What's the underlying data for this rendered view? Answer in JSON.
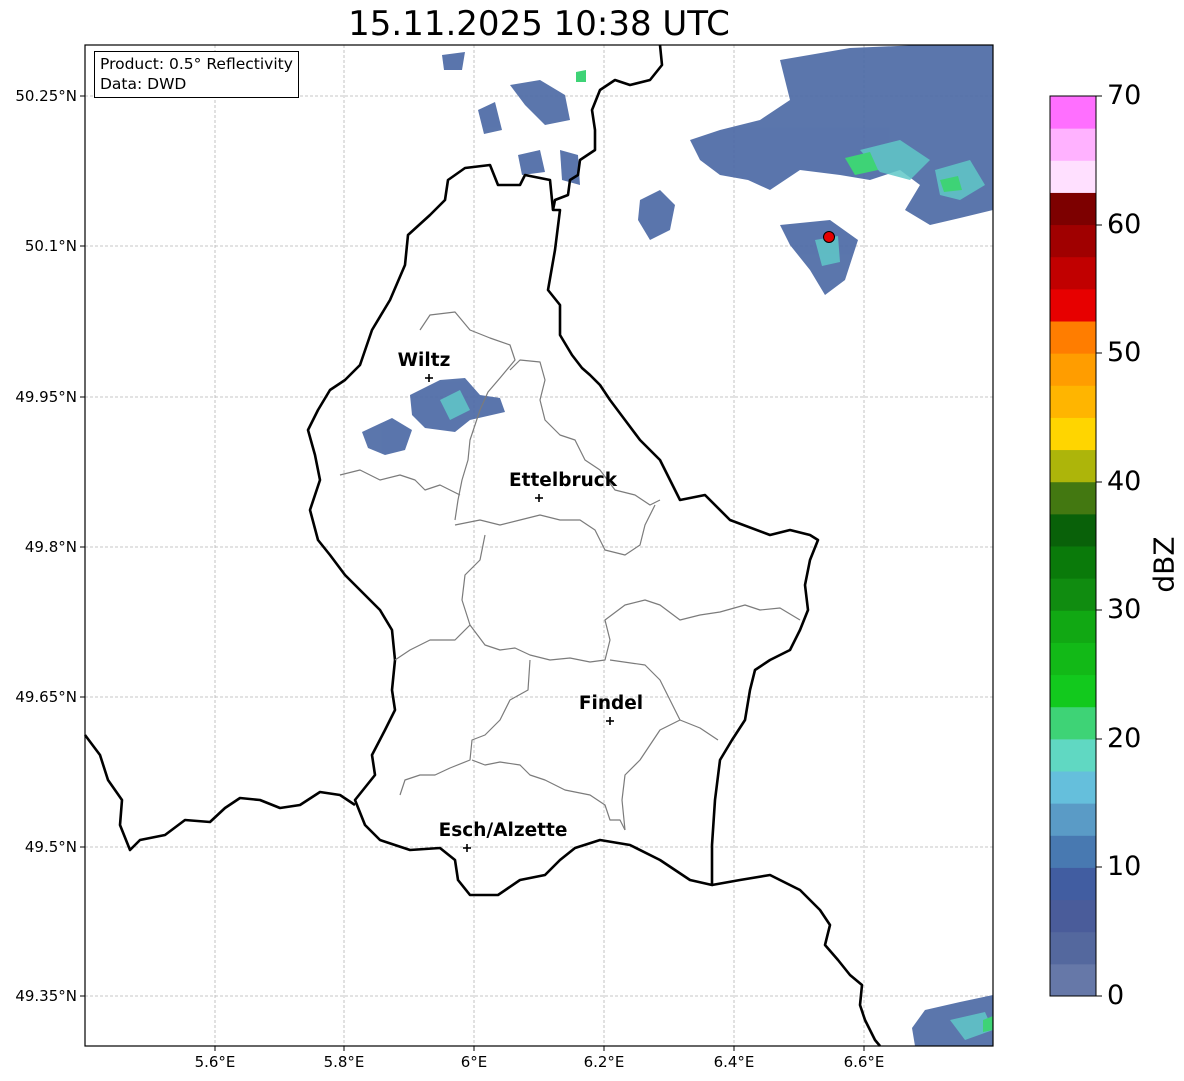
{
  "title": "15.11.2025 10:38 UTC",
  "info": {
    "product": "Product: 0.5° Reflectivity",
    "data": "Data: DWD"
  },
  "axes": {
    "lat_ticks": [
      "50.25°N",
      "50.1°N",
      "49.95°N",
      "49.8°N",
      "49.65°N",
      "49.5°N",
      "49.35°N"
    ],
    "lon_ticks": [
      "5.6°E",
      "5.8°E",
      "6°E",
      "6.2°E",
      "6.4°E",
      "6.6°E"
    ]
  },
  "colorbar": {
    "unit": "dBZ",
    "ticks": [
      "0",
      "10",
      "20",
      "30",
      "40",
      "50",
      "60",
      "70"
    ],
    "min": 0,
    "max": 70,
    "step": 2.5,
    "colors": [
      "#6678a8",
      "#54689e",
      "#4a5c9a",
      "#415da1",
      "#4879b1",
      "#5a9bc6",
      "#65bfdc",
      "#60d8c2",
      "#3ed376",
      "#12c91d",
      "#12b917",
      "#11a813",
      "#108c10",
      "#0a7a0a",
      "#096109",
      "#437811",
      "#adb50a",
      "#ffd500",
      "#ffb500",
      "#ff9d00",
      "#ff7d00",
      "#e70000",
      "#c10000",
      "#a00000",
      "#7d0000",
      "#ffe0ff",
      "#ffb2ff",
      "#ff6fff",
      "#ea3df0"
    ]
  },
  "cities": [
    {
      "name": "Wiltz"
    },
    {
      "name": "Ettelbruck"
    },
    {
      "name": "Findel"
    },
    {
      "name": "Esch/Alzette"
    }
  ],
  "radar_site": {
    "color": "#ff0000"
  }
}
